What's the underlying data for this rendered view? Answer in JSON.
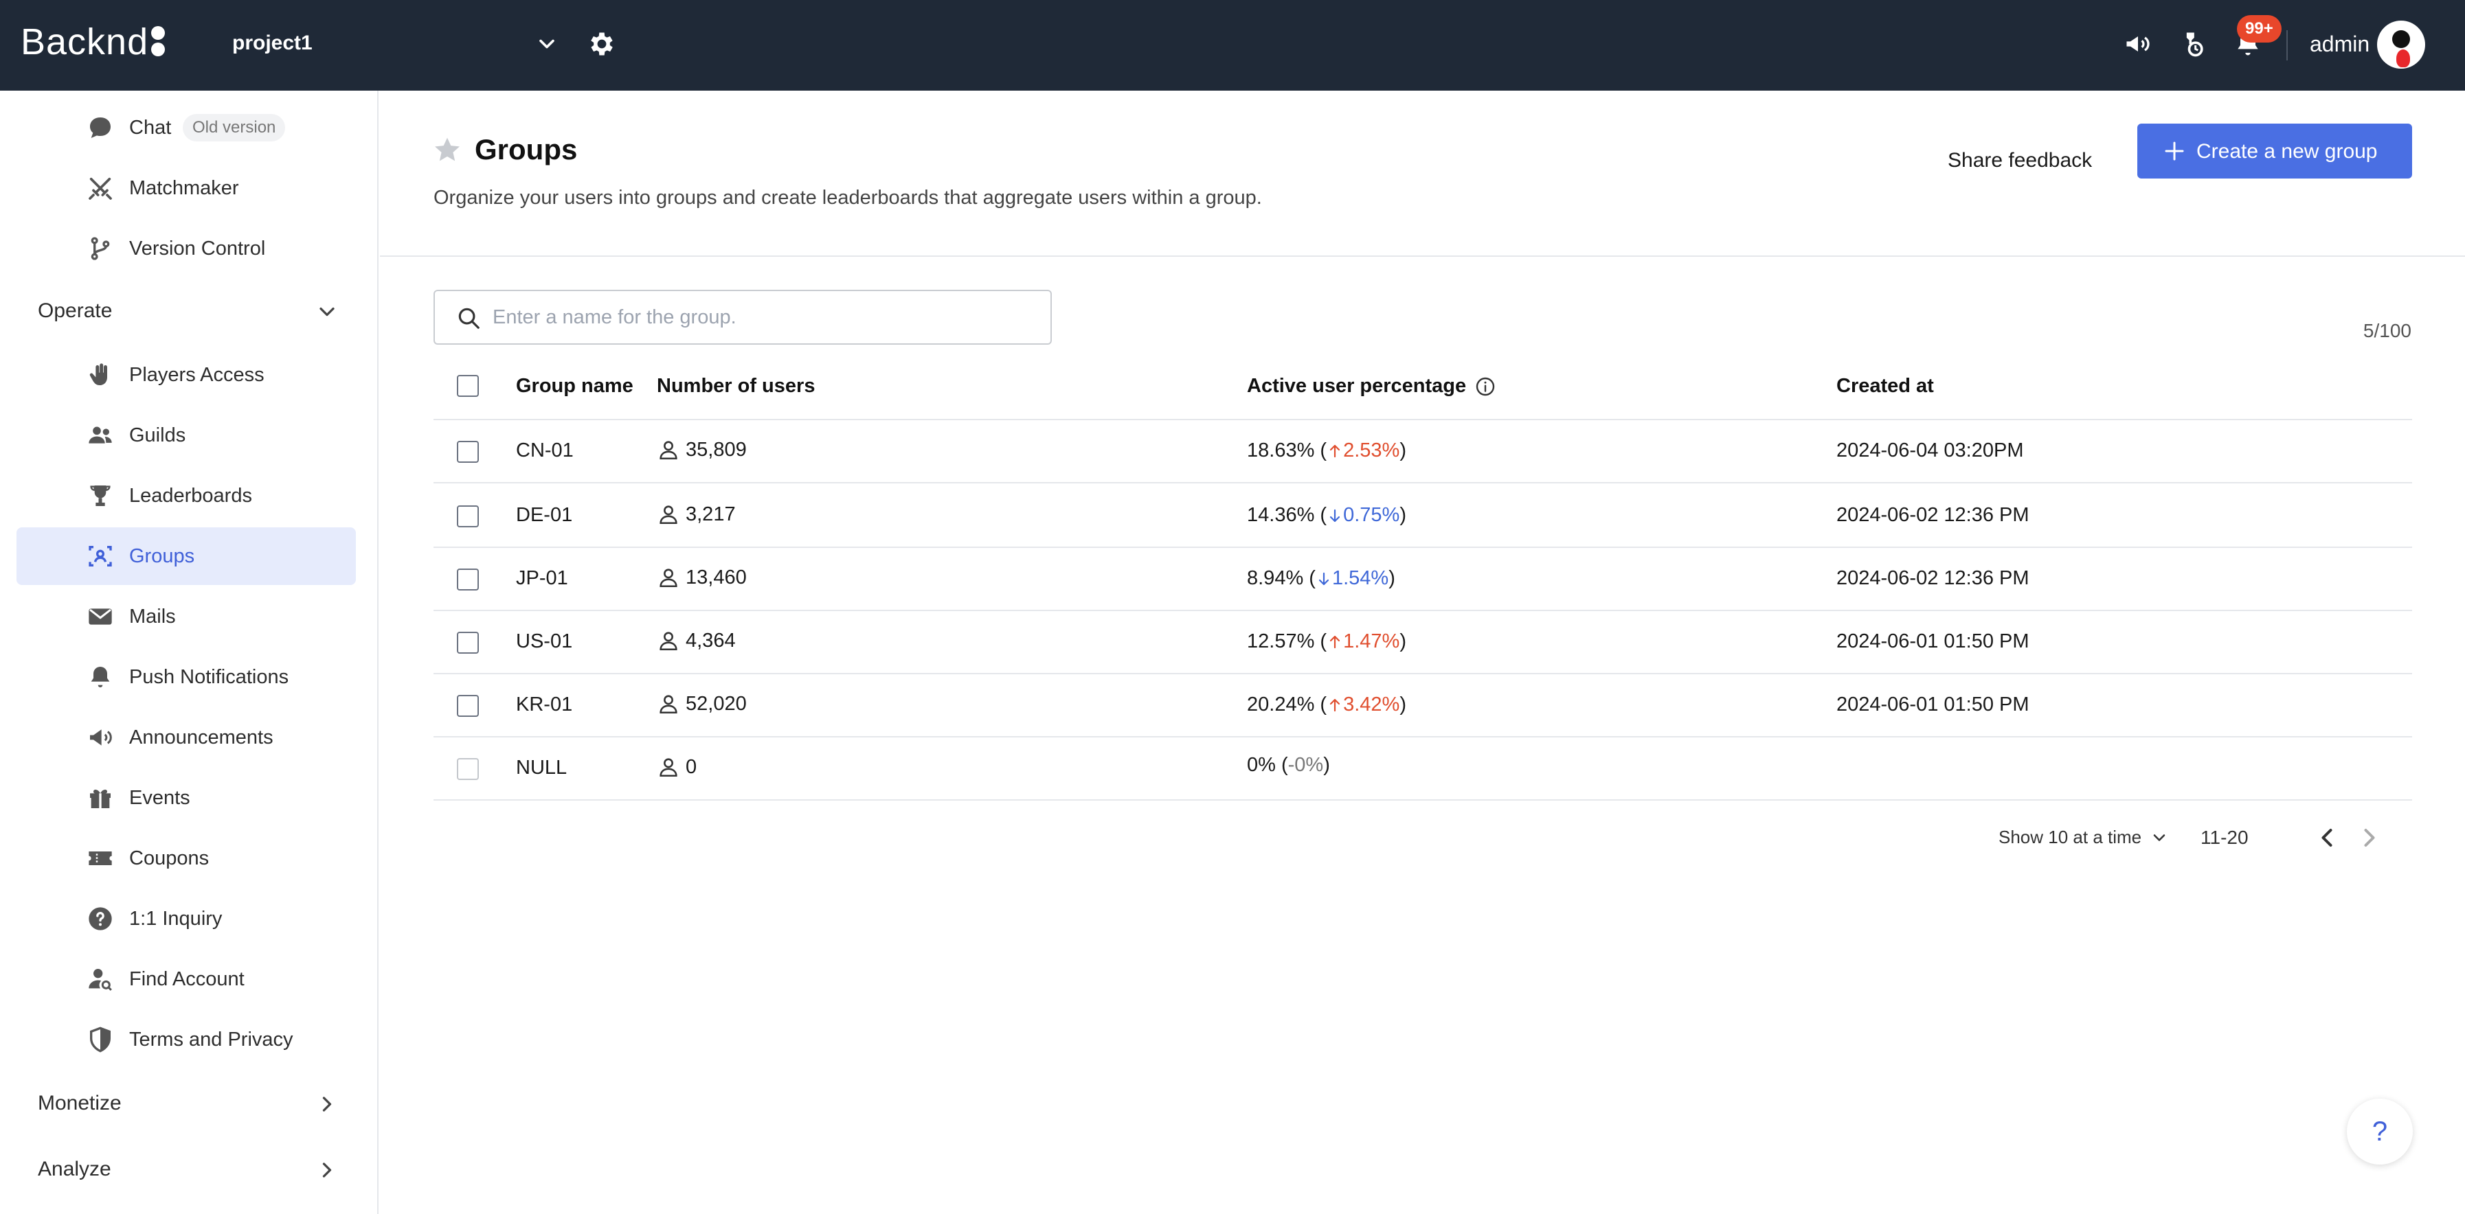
{
  "topbar": {
    "logo": "Backnd",
    "project": "project1",
    "notifications_badge": "99+",
    "username": "admin"
  },
  "sidebar": {
    "items_top": [
      {
        "label": "Chat",
        "badge": "Old version",
        "icon": "chat-icon"
      },
      {
        "label": "Matchmaker",
        "icon": "swords-icon"
      },
      {
        "label": "Version Control",
        "icon": "branch-icon"
      }
    ],
    "sections": {
      "operate": "Operate",
      "monetize": "Monetize",
      "analyze": "Analyze"
    },
    "operate_items": [
      {
        "label": "Players Access",
        "icon": "hand-icon"
      },
      {
        "label": "Guilds",
        "icon": "users-icon"
      },
      {
        "label": "Leaderboards",
        "icon": "trophy-icon"
      },
      {
        "label": "Groups",
        "icon": "group-icon",
        "active": true
      },
      {
        "label": "Mails",
        "icon": "mail-icon"
      },
      {
        "label": "Push Notifications",
        "icon": "bell-icon"
      },
      {
        "label": "Announcements",
        "icon": "megaphone-icon"
      },
      {
        "label": "Events",
        "icon": "gift-icon"
      },
      {
        "label": "Coupons",
        "icon": "ticket-icon"
      },
      {
        "label": "1:1 Inquiry",
        "icon": "question-icon"
      },
      {
        "label": "Find Account",
        "icon": "user-search-icon"
      },
      {
        "label": "Terms and Privacy",
        "icon": "shield-icon"
      }
    ]
  },
  "page": {
    "title": "Groups",
    "description": "Organize your users into groups and create leaderboards that aggregate users within a group.",
    "share_feedback": "Share feedback",
    "create_button": "Create a new group",
    "search_placeholder": "Enter a name for the group.",
    "count": "5/100"
  },
  "table": {
    "headers": {
      "group_name": "Group name",
      "users": "Number of users",
      "active": "Active user percentage",
      "created": "Created at"
    },
    "rows": [
      {
        "name": "CN-01",
        "users": "35,809",
        "pct": "18.63%",
        "change": "2.53%",
        "dir": "up",
        "created": "2024-06-04 03:20PM"
      },
      {
        "name": "DE-01",
        "users": "3,217",
        "pct": "14.36%",
        "change": "0.75%",
        "dir": "down",
        "created": "2024-06-02 12:36 PM"
      },
      {
        "name": "JP-01",
        "users": "13,460",
        "pct": "8.94%",
        "change": "1.54%",
        "dir": "down",
        "created": "2024-06-02 12:36 PM"
      },
      {
        "name": "US-01",
        "users": "4,364",
        "pct": "12.57%",
        "change": "1.47%",
        "dir": "up",
        "created": "2024-06-01 01:50  PM"
      },
      {
        "name": "KR-01",
        "users": "52,020",
        "pct": "20.24%",
        "change": "3.42%",
        "dir": "up",
        "created": "2024-06-01 01:50  PM"
      },
      {
        "name": "NULL",
        "users": "0",
        "pct": "0%",
        "change": "-0%",
        "dir": "none",
        "created": ""
      }
    ]
  },
  "pager": {
    "show": "Show 10 at a time",
    "range": "11-20"
  },
  "help": "?",
  "colors": {
    "topbar": "#1f2937",
    "accent": "#4a6fe3",
    "up": "#e04e2e",
    "down": "#3f68d8",
    "badge": "#e8472b"
  }
}
